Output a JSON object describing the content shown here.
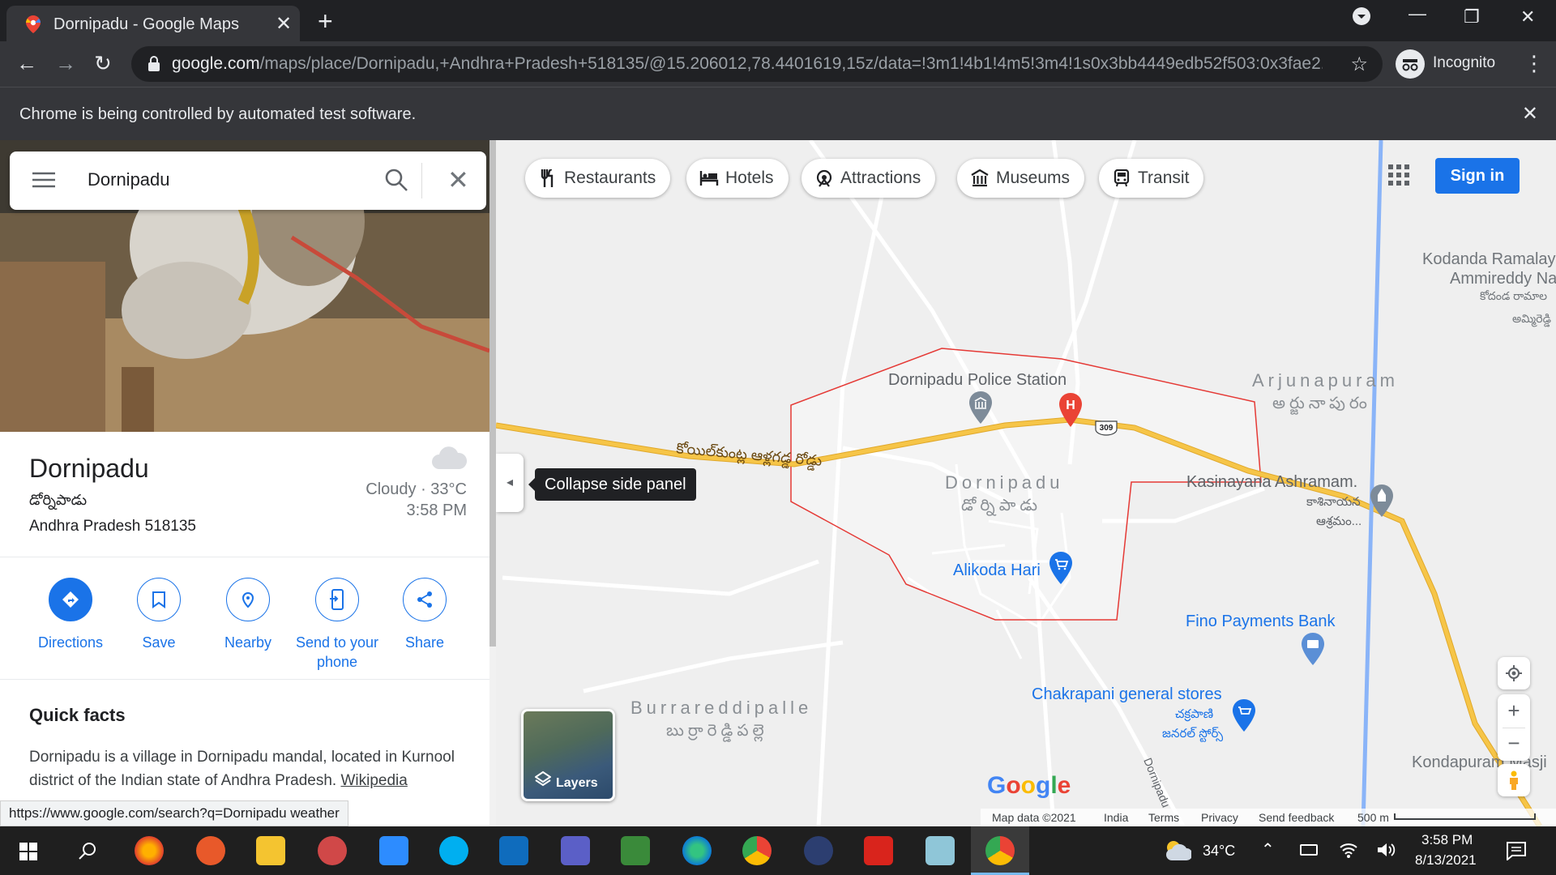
{
  "browser": {
    "tab_title": "Dornipadu - Google Maps",
    "url_host": "google.com",
    "url_path": "/maps/place/Dornipadu,+Andhra+Pradesh+518135/@15.206012,78.4401619,15z/data=!3m1!4b1!4m5!3m4!1s0x3bb4449edb52f503:0x3fae2...",
    "profile_label": "Incognito",
    "infobar_message": "Chrome is being controlled by automated test software."
  },
  "search": {
    "query": "Dornipadu"
  },
  "place": {
    "name": "Dornipadu",
    "native_name": "డోర్నిపాడు",
    "address": "Andhra Pradesh 518135",
    "weather_line": "Cloudy · 33°C",
    "weather_time": "3:58 PM"
  },
  "actions": [
    {
      "label": "Directions",
      "icon": "directions-icon"
    },
    {
      "label": "Save",
      "icon": "bookmark-icon"
    },
    {
      "label": "Nearby",
      "icon": "nearby-icon"
    },
    {
      "label": "Send to your phone",
      "icon": "send-to-phone-icon"
    },
    {
      "label": "Share",
      "icon": "share-icon"
    }
  ],
  "quick_facts": {
    "heading": "Quick facts",
    "text": "Dornipadu is a village in Dornipadu mandal, located in Kurnool district of the Indian state of Andhra Pradesh.",
    "link": "Wikipedia"
  },
  "status_url": "https://www.google.com/search?q=Dornipadu weather",
  "map": {
    "chips": [
      "Restaurants",
      "Hotels",
      "Attractions",
      "Museums",
      "Transit"
    ],
    "sign_in": "Sign in",
    "collapse_tooltip": "Collapse side panel",
    "layers_label": "Layers",
    "labels": {
      "police": "Dornipadu Police Station",
      "town": "Dornipadu",
      "town_native": "డోర్నిపాడు",
      "alikoda": "Alikoda Hari",
      "arjunapuram": "Arjunapuram",
      "arjunapuram_native": "అర్జునాపురం",
      "kasinayana": "Kasinayana Ashramam.",
      "kasinayana_native_1": "కాశినాయన",
      "kasinayana_native_2": "ఆశ్రమం...",
      "kodanda_1": "Kodanda Ramalay",
      "kodanda_2": "Ammireddy Na",
      "kodanda_native_1": "కోదండ రామాల",
      "kodanda_native_2": "అమ్మిరెడ్డి",
      "fino": "Fino Payments Bank",
      "chakrapani": "Chakrapani general stores",
      "chakrapani_native_1": "చక్రపాణి",
      "chakrapani_native_2": "జనరల్ స్టోర్స్",
      "burrareddipalle": "Burrareddipalle",
      "burrareddipalle_native": "బుర్రారెడ్డిపల్లె",
      "kondapuram": "Kondapuram Masji",
      "road_native": "కోయిల్‌కుంట్ల ఆళ్లగడ్డ రోడ్డు",
      "road_side": "Dornipadu",
      "route_shield": "309"
    },
    "footer": {
      "map_data": "Map data ©2021",
      "country": "India",
      "terms": "Terms",
      "privacy": "Privacy",
      "feedback": "Send feedback",
      "scale": "500 m"
    },
    "brand": "Google"
  },
  "taskbar": {
    "temperature": "34°C",
    "time": "3:58 PM",
    "date": "8/13/2021"
  },
  "colors": {
    "accent": "#1a73e8",
    "road": "#f6c548",
    "boundary": "#e53935",
    "pin_red": "#ea4335"
  }
}
